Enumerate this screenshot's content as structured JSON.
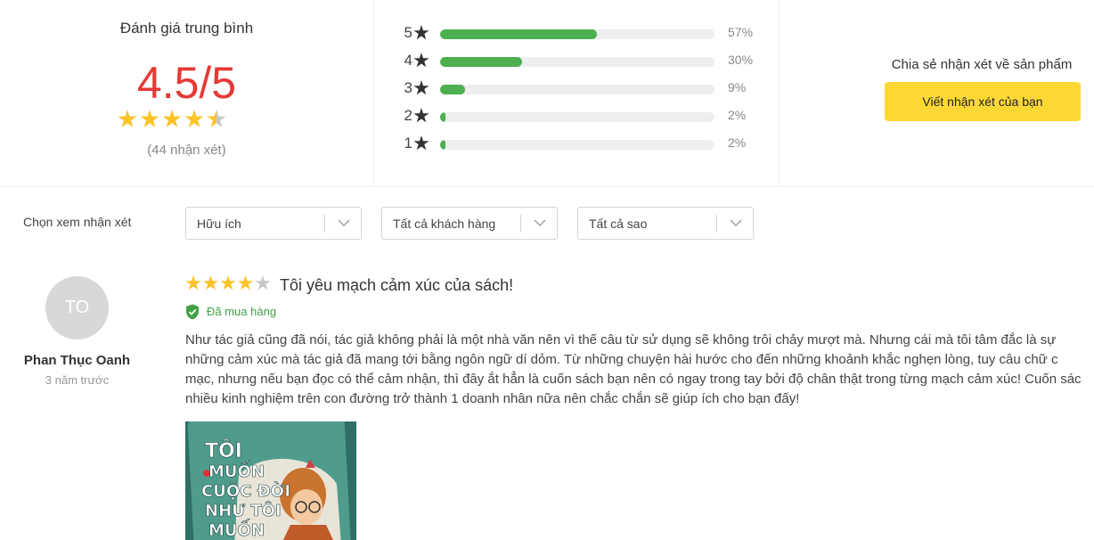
{
  "summary": {
    "title": "Đánh giá trung bình",
    "score": "4.5/5",
    "rating": 4.5,
    "count_text": "(44 nhận xét)",
    "distribution": [
      {
        "stars": "5",
        "percent": 57,
        "label": "57%"
      },
      {
        "stars": "4",
        "percent": 30,
        "label": "30%"
      },
      {
        "stars": "3",
        "percent": 9,
        "label": "9%"
      },
      {
        "stars": "2",
        "percent": 2,
        "label": "2%"
      },
      {
        "stars": "1",
        "percent": 2,
        "label": "2%"
      }
    ],
    "share_title": "Chia sẻ nhận xét về sản phẩm",
    "write_button": "Viết nhận xét của bạn"
  },
  "filters": {
    "label": "Chọn xem nhận xét",
    "options": [
      "Hữu ích",
      "Tất cả khách hàng",
      "Tất cả sao"
    ]
  },
  "review": {
    "avatar_initials": "TO",
    "name": "Phan Thục Oanh",
    "time": "3 năm trước",
    "rating": 4,
    "title": "Tôi yêu mạch cảm xúc của sách!",
    "verified": "Đã mua hàng",
    "body_lines": [
      "Như tác giả cũng đã nói, tác giả không phải là một nhà văn nên vì thế câu từ sử dụng sẽ không trôi chảy mượt mà. Nhưng cái mà tôi tâm đắc là sự",
      "những cảm xúc mà tác giả đã mang tới bằng ngôn ngữ dí dỏm. Từ những chuyện hài hước cho đến những khoảnh khắc nghẹn lòng, tuy câu chữ c",
      "mạc, nhưng nếu bạn đọc có thể cảm nhận, thì đây ắt hẳn là cuốn sách bạn nên có ngay trong tay bởi độ chân thật trong từng mạch cảm xúc! Cuốn sác",
      "nhiều kinh nghiệm trên con đường trở thành 1 doanh nhân nữa nên chắc chắn sẽ giúp ích cho bạn đấy!"
    ],
    "photo_cover_text": [
      "TÔI",
      "MUỐN",
      "CUỘC ĐỜI",
      "NHƯ TÔI",
      "MUỐN"
    ]
  },
  "colors": {
    "score": "#e53935",
    "star": "#fdc327",
    "star_empty": "#c7c7c7",
    "bar_fill": "#4caf50",
    "button": "#fdd835",
    "verified": "#43a047"
  }
}
